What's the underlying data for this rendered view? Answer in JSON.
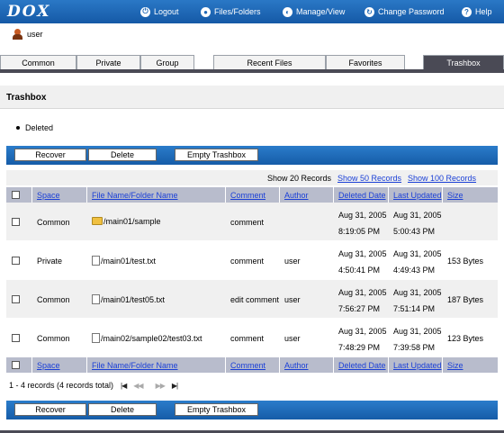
{
  "app": {
    "logo": "DOX"
  },
  "topnav": [
    {
      "label": "Logout",
      "icon": "logout-icon",
      "glyph": "⏻"
    },
    {
      "label": "Files/Folders",
      "icon": "files-folders-icon",
      "glyph": "●"
    },
    {
      "label": "Manage/View",
      "icon": "manage-view-icon",
      "glyph": "◐"
    },
    {
      "label": "Change Password",
      "icon": "change-password-icon",
      "glyph": "↻"
    },
    {
      "label": "Help",
      "icon": "help-icon",
      "glyph": "?"
    }
  ],
  "user": {
    "name": "user"
  },
  "tabs": [
    "Common",
    "Private",
    "Group",
    "Recent Files",
    "Favorites",
    "Trashbox"
  ],
  "active_tab": "Trashbox",
  "page": {
    "title": "Trashbox",
    "message": "Deleted"
  },
  "buttons": {
    "recover": "Recover",
    "delete": "Delete",
    "empty": "Empty Trashbox"
  },
  "show": {
    "current": "Show 20 Records",
    "opt50": "Show 50 Records",
    "opt100": "Show 100 Records"
  },
  "columns": {
    "space": "Space",
    "name": "File Name/Folder Name",
    "comment": "Comment",
    "author": "Author",
    "deleted": "Deleted Date",
    "updated": "Last Updated",
    "size": "Size"
  },
  "rows": [
    {
      "space": "Common",
      "name": "/main01/sample",
      "type": "folder",
      "comment": "comment",
      "author": "",
      "deleted_date": "Aug 31, 2005",
      "deleted_time": "8:19:05 PM",
      "updated_date": "Aug 31, 2005",
      "updated_time": "5:00:43 PM",
      "size": ""
    },
    {
      "space": "Private",
      "name": "/main01/test.txt",
      "type": "file",
      "comment": "comment",
      "author": "user",
      "deleted_date": "Aug 31, 2005",
      "deleted_time": "4:50:41 PM",
      "updated_date": "Aug 31, 2005",
      "updated_time": "4:49:43 PM",
      "size": "153 Bytes"
    },
    {
      "space": "Common",
      "name": "/main01/test05.txt",
      "type": "file",
      "comment": "edit comment",
      "author": "user",
      "deleted_date": "Aug 31, 2005",
      "deleted_time": "7:56:27 PM",
      "updated_date": "Aug 31, 2005",
      "updated_time": "7:51:14 PM",
      "size": "187 Bytes"
    },
    {
      "space": "Common",
      "name": "/main02/sample02/test03.txt",
      "type": "file",
      "comment": "comment",
      "author": "user",
      "deleted_date": "Aug 31, 2005",
      "deleted_time": "7:48:29 PM",
      "updated_date": "Aug 31, 2005",
      "updated_time": "7:39:58 PM",
      "size": "123 Bytes"
    }
  ],
  "pager": {
    "summary": "1 - 4 records (4 records total)",
    "first": "|◀",
    "prev": "◀◀",
    "next": "▶▶",
    "last": "▶|"
  }
}
